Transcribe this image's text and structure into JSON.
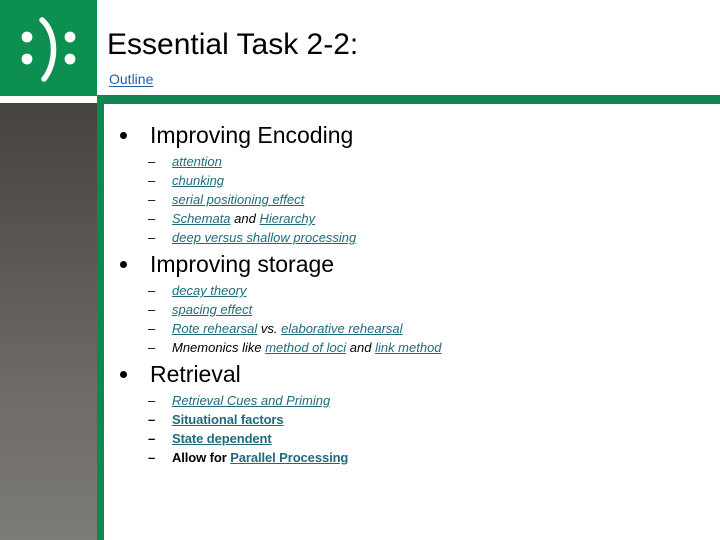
{
  "header": {
    "logo_icon": "smiley-colon-paren-colon-icon",
    "title": "Essential Task 2-2:",
    "subtitle_link": "Outline"
  },
  "colors": {
    "brand_green": "#0d8f52",
    "bar_green": "#128350",
    "link_teal": "#1f6b7b",
    "link_blue": "#1f5fa9",
    "text_black": "#000000",
    "side_strip_top": "#46423f",
    "side_strip_bottom": "#7d7b76"
  },
  "outline": [
    {
      "heading": "Improving Encoding",
      "items": [
        {
          "style": "italic",
          "parts": [
            {
              "text": "attention",
              "link": true
            }
          ]
        },
        {
          "style": "italic",
          "parts": [
            {
              "text": "chunking",
              "link": true
            }
          ]
        },
        {
          "style": "italic",
          "parts": [
            {
              "text": "serial positioning effect",
              "link": true
            }
          ]
        },
        {
          "style": "italic",
          "parts": [
            {
              "text": "Schemata",
              "link": true
            },
            {
              "text": " and ",
              "link": false
            },
            {
              "text": "Hierarchy",
              "link": true
            }
          ]
        },
        {
          "style": "italic",
          "parts": [
            {
              "text": "deep versus shallow processing",
              "link": true
            }
          ]
        }
      ]
    },
    {
      "heading": "Improving storage",
      "items": [
        {
          "style": "italic",
          "parts": [
            {
              "text": "decay theory",
              "link": true
            }
          ]
        },
        {
          "style": "italic",
          "parts": [
            {
              "text": "spacing effect",
              "link": true
            }
          ]
        },
        {
          "style": "italic",
          "parts": [
            {
              "text": "Rote rehearsal",
              "link": true
            },
            {
              "text": " vs. ",
              "link": false
            },
            {
              "text": "elaborative rehearsal",
              "link": true
            }
          ]
        },
        {
          "style": "italic",
          "parts": [
            {
              "text": "Mnemonics like ",
              "link": false
            },
            {
              "text": "method of loci",
              "link": true
            },
            {
              "text": " and ",
              "link": false
            },
            {
              "text": "link method",
              "link": true
            }
          ]
        }
      ]
    },
    {
      "heading": "Retrieval",
      "items": [
        {
          "style": "italic",
          "parts": [
            {
              "text": "Retrieval Cues and Priming",
              "link": true
            }
          ]
        },
        {
          "style": "upright",
          "parts": [
            {
              "text": "Situational factors",
              "link": true
            }
          ]
        },
        {
          "style": "upright",
          "parts": [
            {
              "text": "State dependent",
              "link": true
            }
          ]
        },
        {
          "style": "upright",
          "parts": [
            {
              "text": "Allow for ",
              "link": false
            },
            {
              "text": "Parallel Processing",
              "link": true
            }
          ]
        }
      ]
    }
  ],
  "markers": {
    "bullet": "•",
    "dash": "–"
  }
}
